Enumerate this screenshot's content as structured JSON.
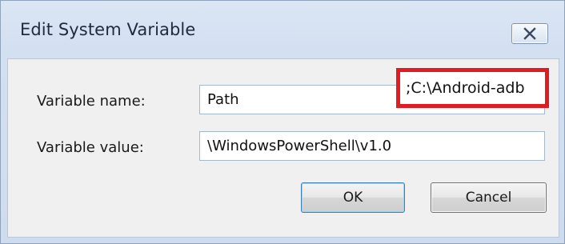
{
  "window": {
    "title": "Edit System Variable",
    "close_icon": "close-icon"
  },
  "form": {
    "name_label": "Variable name:",
    "name_value": "Path",
    "value_label": "Variable value:",
    "value_text": "\\WindowsPowerShell\\v1.0\\;C:\\Android-adb",
    "value_visible_left": "\\WindowsPowerShell\\v1.0",
    "value_highlighted": ";C:\\Android-adb",
    "highlight_color": "#e01b22"
  },
  "buttons": {
    "ok_label": "OK",
    "cancel_label": "Cancel"
  }
}
